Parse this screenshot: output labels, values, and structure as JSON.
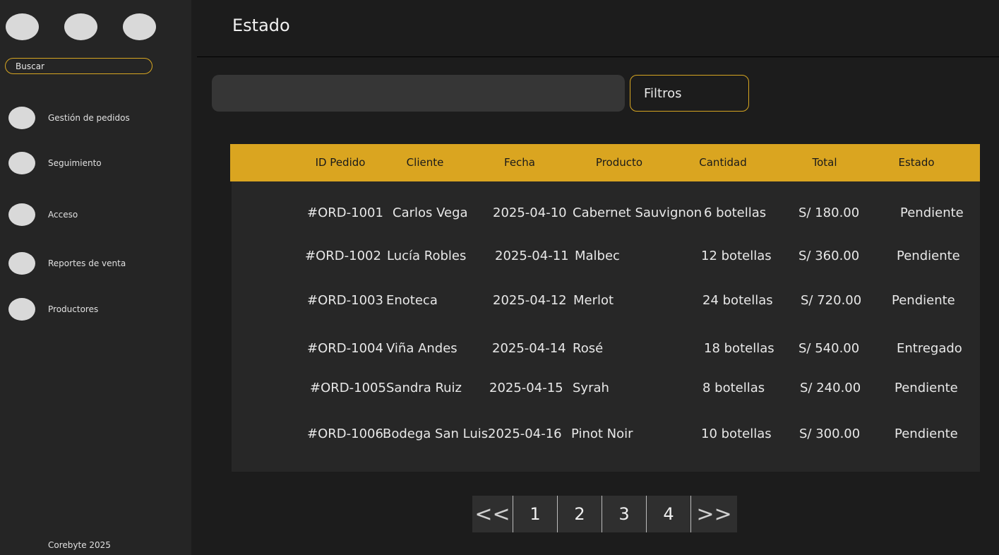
{
  "sidebar": {
    "search_placeholder": "Buscar",
    "items": [
      {
        "label": "Gestión de pedidos"
      },
      {
        "label": "Seguimiento"
      },
      {
        "label": "Acceso"
      },
      {
        "label": "Reportes de venta"
      },
      {
        "label": "Productores"
      }
    ],
    "footer": "Corebyte 2025"
  },
  "header": {
    "title": "Estado"
  },
  "toolbar": {
    "search_value": "",
    "filters_label": "Filtros"
  },
  "table": {
    "columns": [
      "ID Pedido",
      "Cliente",
      "Fecha",
      "Producto",
      "Cantidad",
      "Total",
      "Estado"
    ],
    "rows": [
      [
        "#ORD-1001",
        "Carlos Vega",
        "2025-04-10",
        "Cabernet Sauvignon",
        "6 botellas",
        "S/ 180.00",
        "Pendiente"
      ],
      [
        "#ORD-1002",
        "Lucía Robles",
        "2025-04-11",
        "Malbec",
        "12 botellas",
        "S/ 360.00",
        "Pendiente"
      ],
      [
        "#ORD-1003",
        "Enoteca",
        "2025-04-12",
        "Merlot",
        "24 botellas",
        "S/ 720.00",
        "Pendiente"
      ],
      [
        "#ORD-1004",
        "Viña Andes",
        "2025-04-14",
        "Rosé",
        "18 botellas",
        "S/ 540.00",
        "Entregado"
      ],
      [
        "#ORD-1005",
        "Sandra Ruiz",
        "2025-04-15",
        "Syrah",
        "8 botellas",
        "S/ 240.00",
        "Pendiente"
      ],
      [
        "#ORD-1006",
        "Bodega San Luis",
        "2025-04-16",
        "Pinot Noir",
        "10 botellas",
        "S/ 300.00",
        "Pendiente"
      ]
    ]
  },
  "pagination": {
    "prev": "<<",
    "pages": [
      "1",
      "2",
      "3",
      "4"
    ],
    "next": ">>"
  },
  "colors": {
    "accent": "#daa520",
    "background": "#1c1c1c",
    "sidebar": "#252525"
  }
}
